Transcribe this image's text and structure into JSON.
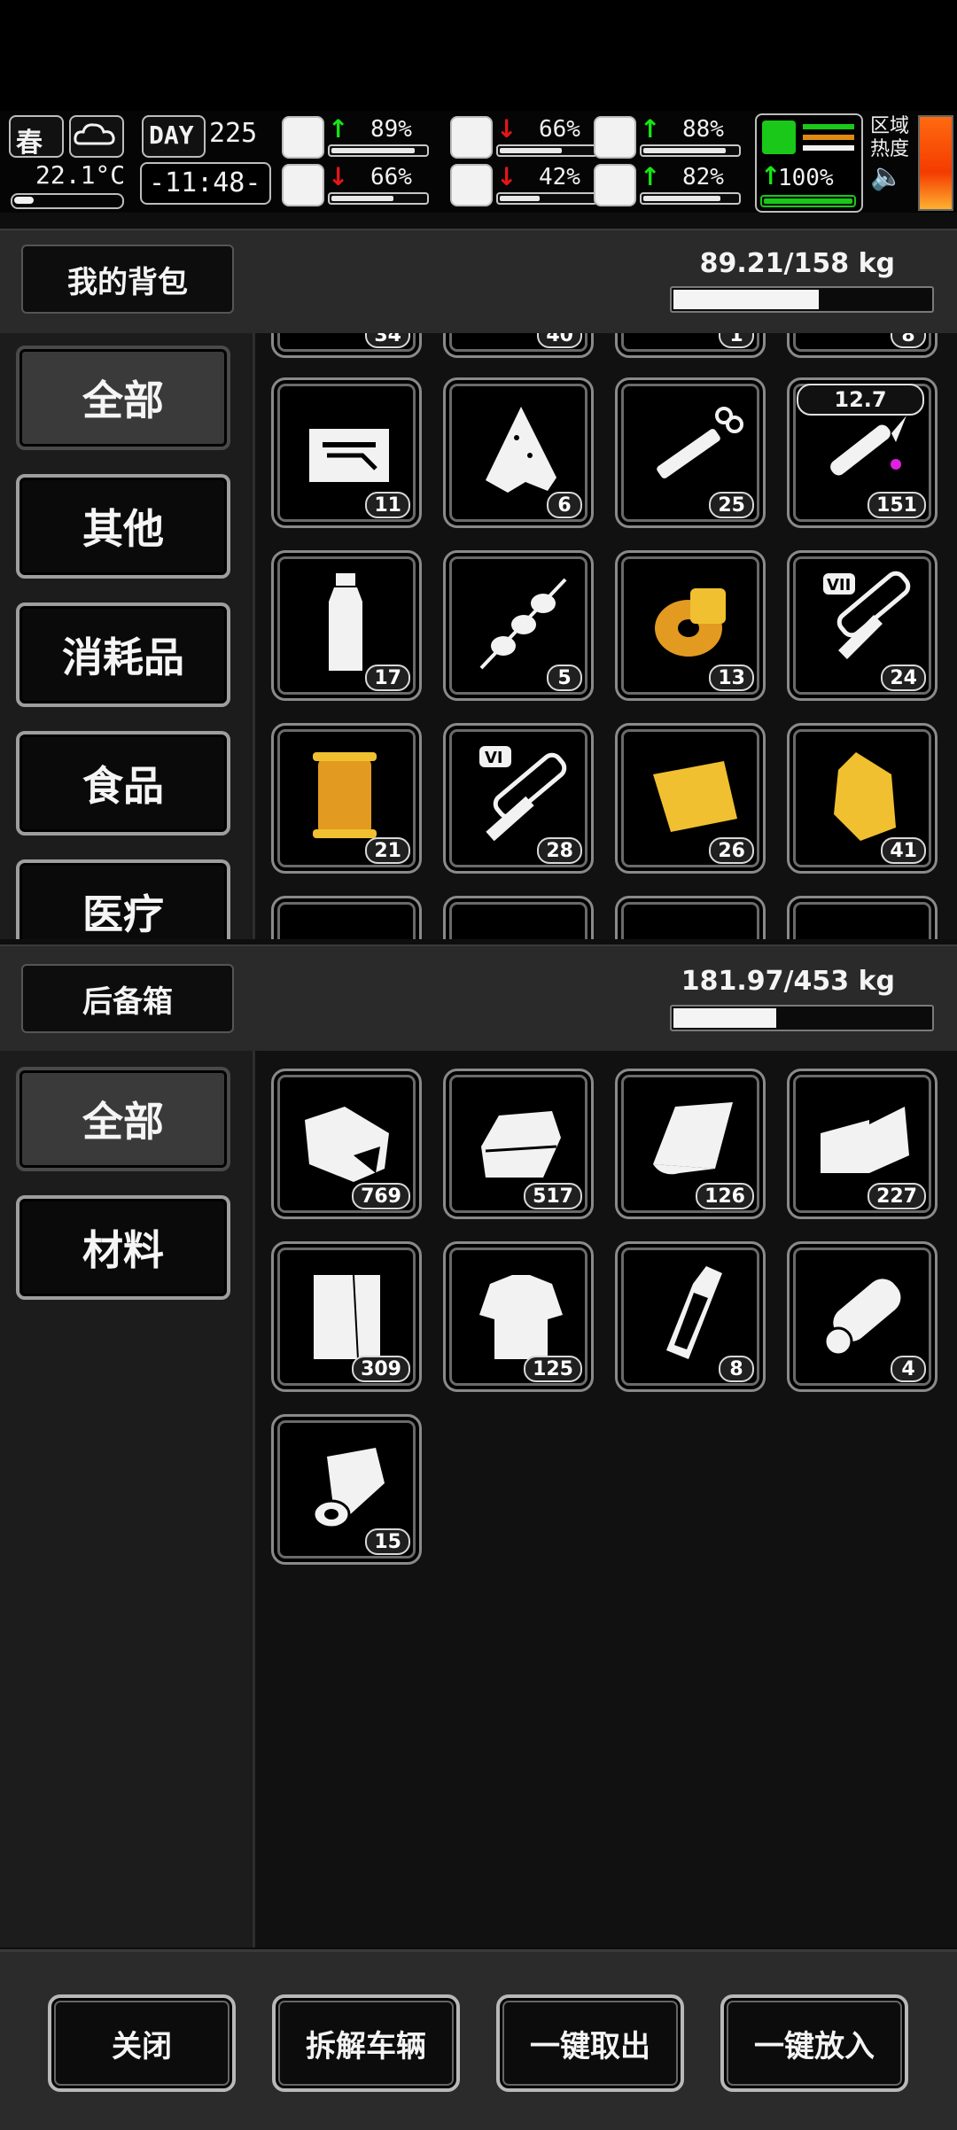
{
  "hud": {
    "season": "春",
    "temperature": "22.1°C",
    "day_label": "DAY",
    "day_number": "225",
    "clock": "-11:48-",
    "stats": [
      {
        "name": "health",
        "value": "89%",
        "trend": "up",
        "level": 0.89
      },
      {
        "name": "stomach",
        "value": "66%",
        "trend": "down",
        "level": 0.66
      },
      {
        "name": "armor",
        "value": "88%",
        "trend": "up",
        "level": 0.88
      },
      {
        "name": "food",
        "value": "66%",
        "trend": "down",
        "level": 0.66
      },
      {
        "name": "water",
        "value": "42%",
        "trend": "down",
        "level": 0.42
      },
      {
        "name": "heart",
        "value": "82%",
        "trend": "up",
        "level": 0.82
      }
    ],
    "stamina_value": "100%",
    "zone_label_1": "区域",
    "zone_label_2": "热度",
    "colors": {
      "up": "#16e516",
      "down": "#e51616",
      "stamina": "#19c819"
    }
  },
  "backpack": {
    "title": "我的背包",
    "weight": "89.21/158 kg",
    "weight_fraction": 0.565,
    "categories": [
      "全部",
      "其他",
      "消耗品",
      "食品",
      "医疗"
    ],
    "active_category": 0,
    "items": [
      {
        "icon": "toolbox-icon",
        "count": "11"
      },
      {
        "icon": "cloth-rag-icon",
        "count": "6"
      },
      {
        "icon": "syringe-icon",
        "count": "25"
      },
      {
        "icon": "bullet-icon",
        "count": "151",
        "tag": "12.7"
      },
      {
        "icon": "water-bottle-icon",
        "count": "17"
      },
      {
        "icon": "skewer-icon",
        "count": "5"
      },
      {
        "icon": "yellow-spool-icon",
        "count": "13"
      },
      {
        "icon": "test-tube-vii-icon",
        "count": "24",
        "tube": "VII"
      },
      {
        "icon": "thread-spool-icon",
        "count": "21"
      },
      {
        "icon": "test-tube-vi-icon",
        "count": "28",
        "tube": "VI"
      },
      {
        "icon": "yellow-cloth-icon",
        "count": "26"
      },
      {
        "icon": "gold-crystal-icon",
        "count": "41"
      }
    ],
    "partial_top_counts": [
      "34",
      "40",
      "1",
      "8"
    ]
  },
  "trunk": {
    "title": "后备箱",
    "weight": "181.97/453 kg",
    "weight_fraction": 0.4,
    "categories": [
      "全部",
      "材料"
    ],
    "active_category": 0,
    "items": [
      {
        "icon": "torn-fabric-icon",
        "count": "769"
      },
      {
        "icon": "folded-cloth-icon",
        "count": "517"
      },
      {
        "icon": "towel-icon",
        "count": "126"
      },
      {
        "icon": "fabric-sheet-icon",
        "count": "227"
      },
      {
        "icon": "paper-stack-icon",
        "count": "309"
      },
      {
        "icon": "torn-shirt-icon",
        "count": "125"
      },
      {
        "icon": "plastic-bottle-icon",
        "count": "8"
      },
      {
        "icon": "wood-log-icon",
        "count": "4"
      },
      {
        "icon": "paper-roll-icon",
        "count": "15"
      }
    ]
  },
  "actions": {
    "close": "关闭",
    "dismantle": "拆解车辆",
    "take_all": "一键取出",
    "put_all": "一键放入"
  }
}
